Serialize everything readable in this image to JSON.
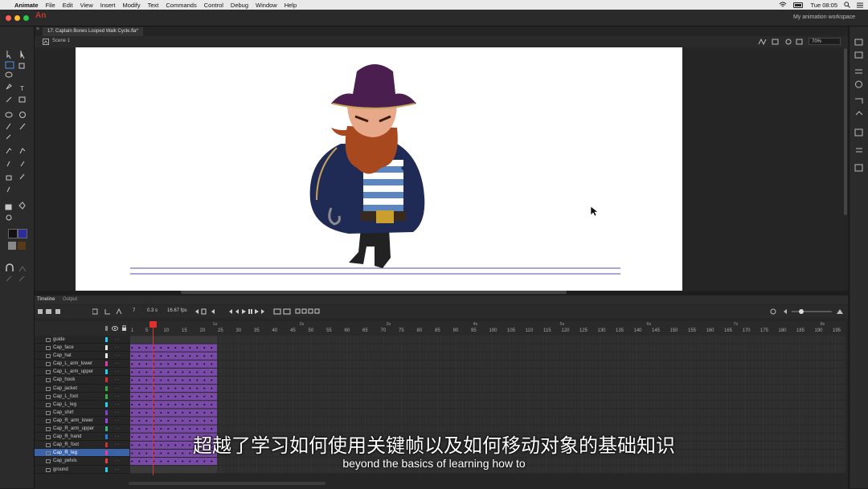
{
  "menubar": {
    "app": "Animate",
    "items": [
      "File",
      "Edit",
      "View",
      "Insert",
      "Modify",
      "Text",
      "Commands",
      "Control",
      "Debug",
      "Window",
      "Help"
    ],
    "time": "Tue 08:05"
  },
  "window": {
    "logo": "An",
    "workspace": "My animation workspace",
    "doc_tab": "17. Captain Bones Looped Walk Cycle.fla*",
    "scene": "Scene 1",
    "zoom": "70%"
  },
  "timeline": {
    "tabs": [
      "Timeline",
      "Output"
    ],
    "current_frame": "7",
    "time_readout": "0.3 s",
    "fps": "16.67 fps",
    "sec_labels": [
      "1s",
      "2s",
      "3s",
      "4s",
      "5s",
      "6s",
      "7s",
      "8s"
    ],
    "frame_ticks": [
      "1",
      "5",
      "10",
      "15",
      "20",
      "25",
      "30",
      "35",
      "40",
      "45",
      "50",
      "55",
      "60",
      "65",
      "70",
      "75",
      "80",
      "85",
      "90",
      "95",
      "100",
      "105",
      "110",
      "115",
      "120",
      "125",
      "130",
      "135",
      "140",
      "145",
      "150",
      "155",
      "160",
      "165",
      "170",
      "175",
      "180",
      "185",
      "190",
      "195"
    ],
    "layers": [
      {
        "name": "guide",
        "color": "#25d0e8"
      },
      {
        "name": "Cap_face",
        "color": "#e8e8e8"
      },
      {
        "name": "Cap_hat",
        "color": "#e8e8e8"
      },
      {
        "name": "Cap_L_arm_lower",
        "color": "#e040a0"
      },
      {
        "name": "Cap_L_arm_upper",
        "color": "#25d0e8"
      },
      {
        "name": "Cap_hook",
        "color": "#d03030"
      },
      {
        "name": "Cap_jacket",
        "color": "#30b040"
      },
      {
        "name": "Cap_L_foot",
        "color": "#30b040"
      },
      {
        "name": "Cap_L_leg",
        "color": "#25d0e8"
      },
      {
        "name": "Cap_shirt",
        "color": "#8040d0"
      },
      {
        "name": "Cap_R_arm_lower",
        "color": "#a040e0"
      },
      {
        "name": "Cap_R_arm_upper",
        "color": "#30c080"
      },
      {
        "name": "Cap_R_hand",
        "color": "#2080e0"
      },
      {
        "name": "Cap_R_foot",
        "color": "#d03030"
      },
      {
        "name": "Cap_R_leg",
        "color": "#e040a0"
      },
      {
        "name": "Cap_pelvis",
        "color": "#e04040"
      },
      {
        "name": "ground",
        "color": "#25d0e8"
      }
    ],
    "selected_layer": "Cap_R_leg"
  },
  "subtitles": {
    "cn": "超越了学习如何使用关键帧以及如何移动对象的基础知识",
    "en": "beyond the basics of learning how to"
  }
}
